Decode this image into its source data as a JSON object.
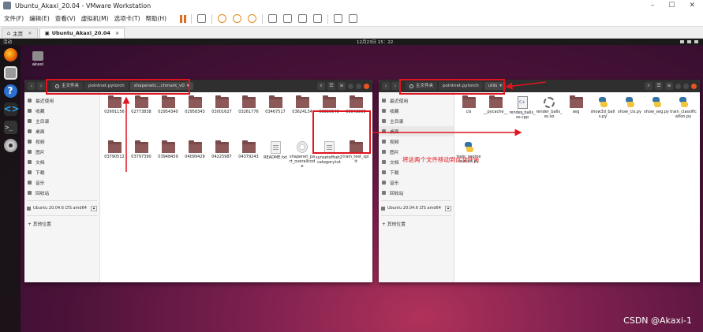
{
  "vmware": {
    "title": "Ubuntu_Akaxi_20.04 - VMware Workstation",
    "window_controls": [
      "–",
      "☐",
      "✕"
    ],
    "menu": [
      "文件(F)",
      "编辑(E)",
      "查看(V)",
      "虚拟机(M)",
      "选项卡(T)",
      "帮助(H)"
    ],
    "tabs": [
      {
        "label": "主页",
        "active": false
      },
      {
        "label": "Ubuntu_Akaxi_20.04",
        "active": true
      }
    ]
  },
  "guest": {
    "topbar": {
      "activities": "活动",
      "clock": "12月23日 15：22"
    },
    "desktop_icon": {
      "label": "akaxi"
    },
    "dock": [
      "firefox-icon",
      "files-icon",
      "help-icon",
      "vscode-icon",
      "terminal-icon",
      "disc-icon"
    ]
  },
  "left_window": {
    "breadcrumb": [
      "主文件夹",
      "pointnet.pytorch",
      "shapenetc...chmark_v0"
    ],
    "sidebar": {
      "places": [
        "最近使用",
        "收藏",
        "主目录",
        "桌面",
        "视频",
        "图片",
        "文档",
        "下载",
        "音乐",
        "回收站"
      ],
      "device": "Ubuntu 20.04.6 LTS amd64",
      "other": "+ 其他位置"
    },
    "files": [
      {
        "name": "02691156",
        "kind": "folder"
      },
      {
        "name": "02773838",
        "kind": "folder"
      },
      {
        "name": "02954340",
        "kind": "folder"
      },
      {
        "name": "02958343",
        "kind": "folder"
      },
      {
        "name": "03001627",
        "kind": "folder"
      },
      {
        "name": "03261776",
        "kind": "folder"
      },
      {
        "name": "03467517",
        "kind": "folder"
      },
      {
        "name": "03624134",
        "kind": "folder"
      },
      {
        "name": "03636649",
        "kind": "folder"
      },
      {
        "name": "03642806",
        "kind": "folder"
      },
      {
        "name": "03790512",
        "kind": "folder"
      },
      {
        "name": "03797390",
        "kind": "folder"
      },
      {
        "name": "03948459",
        "kind": "folder"
      },
      {
        "name": "04099429",
        "kind": "folder"
      },
      {
        "name": "04225987",
        "kind": "folder"
      },
      {
        "name": "04379243",
        "kind": "folder"
      },
      {
        "name": "README.txt",
        "kind": "doc"
      },
      {
        "name": "shapenet_part_overallcode",
        "kind": "so"
      },
      {
        "name": "synsetoffset2category.txt",
        "kind": "doc"
      },
      {
        "name": "train_test_split",
        "kind": "folder"
      }
    ]
  },
  "right_window": {
    "breadcrumb": [
      "主文件夹",
      "pointnet.pytorch",
      "utils"
    ],
    "sidebar": {
      "places": [
        "最近使用",
        "收藏",
        "主目录",
        "桌面",
        "视频",
        "图片",
        "文档",
        "下载",
        "音乐",
        "回收站"
      ],
      "device": "Ubuntu 20.04.6 LTS amd64",
      "other": "+ 其他位置"
    },
    "files": [
      {
        "name": "cls",
        "kind": "folder"
      },
      {
        "name": "__pycache__",
        "kind": "folder"
      },
      {
        "name": "render_balls_so.cpp",
        "kind": "cpp"
      },
      {
        "name": "render_balls_so.so",
        "kind": "gear"
      },
      {
        "name": "seg",
        "kind": "folder"
      },
      {
        "name": "show3d_balls.py",
        "kind": "py"
      },
      {
        "name": "show_cls.py",
        "kind": "py"
      },
      {
        "name": "show_seg.py",
        "kind": "py"
      },
      {
        "name": "train_classification.py",
        "kind": "py"
      },
      {
        "name": "train_segmentation.py",
        "kind": "py"
      }
    ]
  },
  "annotation": {
    "text": "将这两个文件移动到此文件夹",
    "color": "#e0141e"
  },
  "watermark": "CSDN @Akaxi-1"
}
